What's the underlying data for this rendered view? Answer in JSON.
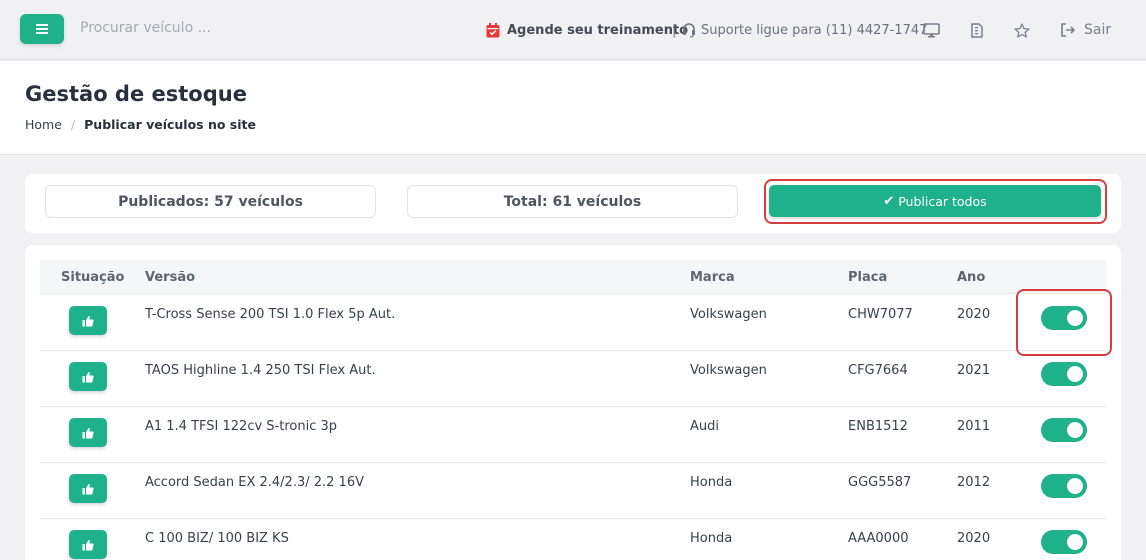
{
  "topbar": {
    "search_placeholder": "Procurar veículo ...",
    "agende_label": "Agende seu treinamento",
    "separator": "|",
    "suporte_label": "Suporte ligue para (11) 4427-1747",
    "sair_label": "Sair",
    "icons": [
      "menu-icon",
      "calendar-icon",
      "headset-icon",
      "monitor-icon",
      "document-icon",
      "star-icon",
      "logout-icon"
    ]
  },
  "header": {
    "title": "Gestão de estoque",
    "breadcrumb_home": "Home",
    "breadcrumb_sep": "/",
    "breadcrumb_current": "Publicar veículos no site"
  },
  "summary": {
    "published": "Publicados: 57 veículos",
    "total": "Total: 61 veículos",
    "publish_all": "Publicar todos"
  },
  "table": {
    "headers": [
      "Situação",
      "Versão",
      "Marca",
      "Placa",
      "Ano"
    ],
    "rows": [
      {
        "versao": "T-Cross Sense 200 TSI 1.0 Flex 5p Aut.",
        "marca": "Volkswagen",
        "placa": "CHW7077",
        "ano": "2020",
        "published": true
      },
      {
        "versao": "TAOS Highline 1.4 250 TSI Flex Aut.",
        "marca": "Volkswagen",
        "placa": "CFG7664",
        "ano": "2021",
        "published": true
      },
      {
        "versao": "A1 1.4 TFSI 122cv S-tronic 3p",
        "marca": "Audi",
        "placa": "ENB1512",
        "ano": "2011",
        "published": true
      },
      {
        "versao": "Accord Sedan EX 2.4/2.3/ 2.2 16V",
        "marca": "Honda",
        "placa": "GGG5587",
        "ano": "2012",
        "published": true
      },
      {
        "versao": "C 100 BIZ/ 100 BIZ KS",
        "marca": "Honda",
        "placa": "AAA0000",
        "ano": "2020",
        "published": true
      }
    ]
  },
  "colors": {
    "accent": "#1fb18a",
    "highlight": "#d63d3d",
    "calendar": "#e53935"
  }
}
